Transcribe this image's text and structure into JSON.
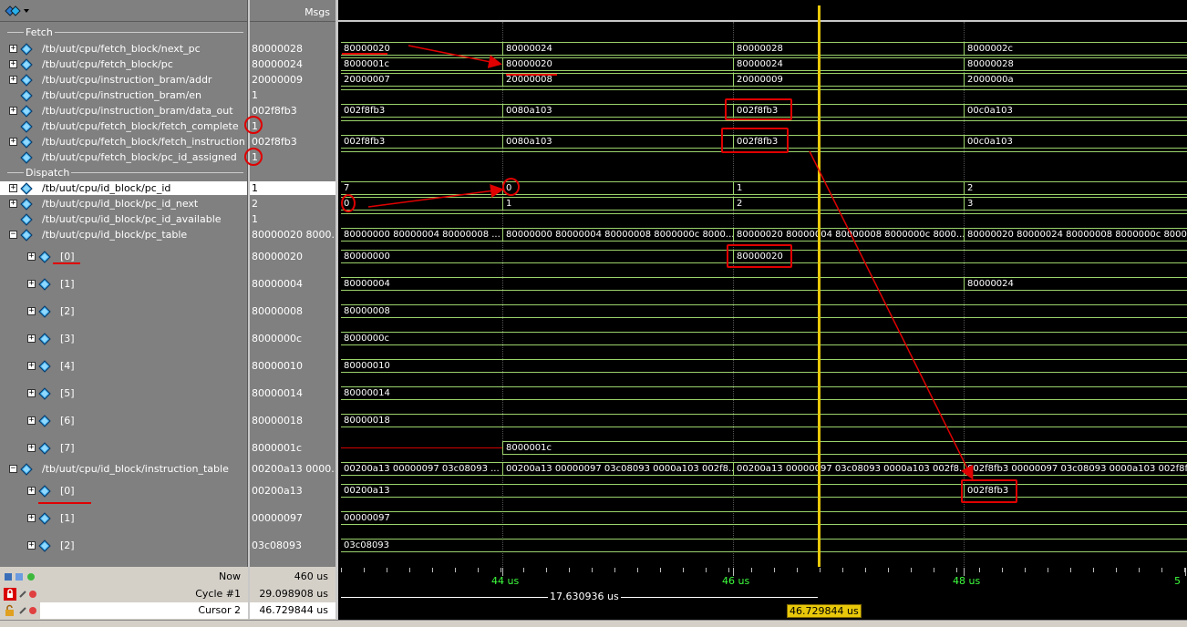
{
  "header": {
    "msgs_label": "Msgs"
  },
  "groups": {
    "fetch": "Fetch",
    "dispatch": "Dispatch"
  },
  "signals": [
    {
      "name": "/tb/uut/cpu/fetch_block/next_pc",
      "value": "80000028",
      "expandable": true
    },
    {
      "name": "/tb/uut/cpu/fetch_block/pc",
      "value": "80000024",
      "expandable": true
    },
    {
      "name": "/tb/uut/cpu/instruction_bram/addr",
      "value": "20000009",
      "expandable": true
    },
    {
      "name": "/tb/uut/cpu/instruction_bram/en",
      "value": "1",
      "expandable": false
    },
    {
      "name": "/tb/uut/cpu/instruction_bram/data_out",
      "value": "002f8fb3",
      "expandable": true
    },
    {
      "name": "/tb/uut/cpu/fetch_block/fetch_complete",
      "value": "1",
      "expandable": false
    },
    {
      "name": "/tb/uut/cpu/fetch_block/fetch_instruction",
      "value": "002f8fb3",
      "expandable": true
    },
    {
      "name": "/tb/uut/cpu/fetch_block/pc_id_assigned",
      "value": "1",
      "expandable": false
    },
    {
      "name": "/tb/uut/cpu/id_block/pc_id",
      "value": "1",
      "expandable": true
    },
    {
      "name": "/tb/uut/cpu/id_block/pc_id_next",
      "value": "2",
      "expandable": true
    },
    {
      "name": "/tb/uut/cpu/id_block/pc_id_available",
      "value": "1",
      "expandable": false
    },
    {
      "name": "/tb/uut/cpu/id_block/pc_table",
      "value": "80000020 8000...",
      "expandable": true
    },
    {
      "name": "[0]",
      "value": "80000020"
    },
    {
      "name": "[1]",
      "value": "80000004"
    },
    {
      "name": "[2]",
      "value": "80000008"
    },
    {
      "name": "[3]",
      "value": "8000000c"
    },
    {
      "name": "[4]",
      "value": "80000010"
    },
    {
      "name": "[5]",
      "value": "80000014"
    },
    {
      "name": "[6]",
      "value": "80000018"
    },
    {
      "name": "[7]",
      "value": "8000001c"
    },
    {
      "name": "/tb/uut/cpu/id_block/instruction_table",
      "value": "00200a13 0000...",
      "expandable": true
    },
    {
      "name": "[0]",
      "value": "00200a13"
    },
    {
      "name": "[1]",
      "value": "00000097"
    },
    {
      "name": "[2]",
      "value": "03c08093"
    }
  ],
  "waves": {
    "next_pc": [
      "80000020",
      "80000024",
      "80000028",
      "8000002c"
    ],
    "pc": [
      "8000001c",
      "80000020",
      "80000024",
      "80000028"
    ],
    "addr": [
      "20000007",
      "20000008",
      "20000009",
      "2000000a"
    ],
    "data_out": [
      "002f8fb3",
      "0080a103",
      "002f8fb3",
      "00c0a103"
    ],
    "fetch_instruction": [
      "002f8fb3",
      "0080a103",
      "002f8fb3",
      "00c0a103"
    ],
    "pc_id": [
      "7",
      "0",
      "1",
      "2"
    ],
    "pc_id_next": [
      "0",
      "1",
      "2",
      "3"
    ],
    "pc_table": [
      "80000000 80000004 80000008 ...",
      "80000000 80000004 80000008 8000000c 8000...",
      "80000020 80000004 80000008 8000000c 8000...",
      "80000020 80000024 80000008 8000000c 8000..."
    ],
    "pc_table_0": [
      "80000000",
      "80000020"
    ],
    "pc_table_1": [
      "80000004",
      "80000024"
    ],
    "pc_table_2": "80000008",
    "pc_table_3": "8000000c",
    "pc_table_4": "80000010",
    "pc_table_5": "80000014",
    "pc_table_6": "80000018",
    "pc_table_7": "8000001c",
    "instr_table": [
      "00200a13 00000097 03c08093 ...",
      "00200a13 00000097 03c08093 0000a103 002f8...",
      "00200a13 00000097 03c08093 0000a103 002f8...",
      "002f8fb3 00000097 03c08093 0000a103 002f8f..."
    ],
    "instr_table_0": [
      "00200a13",
      "002f8fb3"
    ],
    "instr_table_1": "00000097",
    "instr_table_2": "03c08093"
  },
  "status": {
    "now_label": "Now",
    "now_value": "460 us",
    "cycle_label": "Cycle #1",
    "cycle_value": "29.098908 us",
    "cursor_label": "Cursor 2",
    "cursor_value": "46.729844 us"
  },
  "timeline": {
    "ticks": [
      "44 us",
      "46 us",
      "48 us",
      "5"
    ],
    "measurement": "17.630936 us",
    "cursor_badge": "46.729844 us"
  },
  "colors": {
    "wave": "#9bd36b",
    "cursor": "#e8c80a",
    "annotation": "#e00000",
    "ticks": "#3dff3d"
  }
}
